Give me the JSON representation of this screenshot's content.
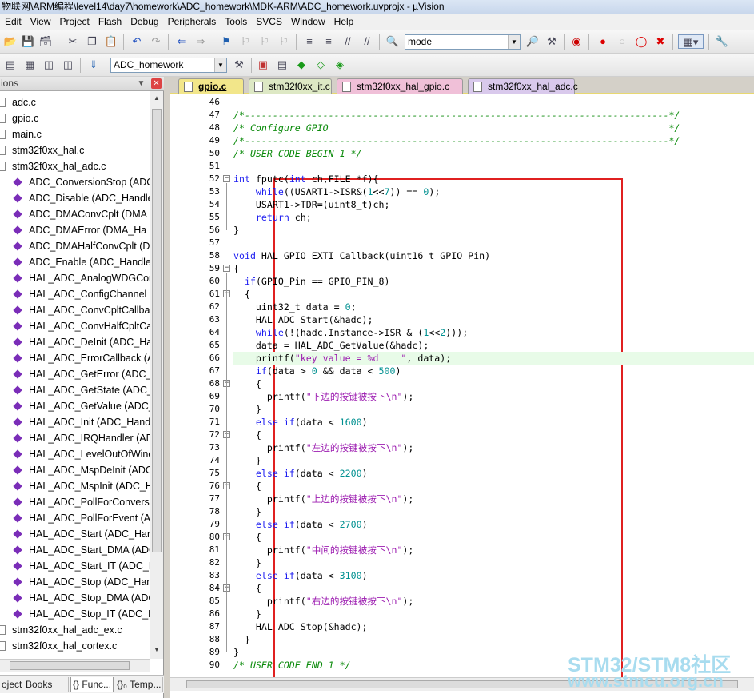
{
  "window": {
    "title": "物联网\\ARM编程\\level14\\day7\\homework\\ADC_homework\\MDK-ARM\\ADC_homework.uvprojx - µVision"
  },
  "menu": [
    "Edit",
    "View",
    "Project",
    "Flash",
    "Debug",
    "Peripherals",
    "Tools",
    "SVCS",
    "Window",
    "Help"
  ],
  "toolbar": {
    "find_value": "mode",
    "target_value": "ADC_homework"
  },
  "project_panel": {
    "title": "ions",
    "tree": [
      {
        "kind": "file",
        "label": "adc.c"
      },
      {
        "kind": "file",
        "label": "gpio.c"
      },
      {
        "kind": "file",
        "label": "main.c"
      },
      {
        "kind": "file",
        "label": "stm32f0xx_hal.c"
      },
      {
        "kind": "file",
        "label": "stm32f0xx_hal_adc.c"
      },
      {
        "kind": "func",
        "label": "ADC_ConversionStop (ADC"
      },
      {
        "kind": "func",
        "label": "ADC_Disable (ADC_Handle"
      },
      {
        "kind": "func",
        "label": "ADC_DMAConvCplt (DMA"
      },
      {
        "kind": "func",
        "label": "ADC_DMAError (DMA_Ha"
      },
      {
        "kind": "func",
        "label": "ADC_DMAHalfConvCplt (D"
      },
      {
        "kind": "func",
        "label": "ADC_Enable (ADC_Handle"
      },
      {
        "kind": "func",
        "label": "HAL_ADC_AnalogWDGCon"
      },
      {
        "kind": "func",
        "label": "HAL_ADC_ConfigChannel ("
      },
      {
        "kind": "func",
        "label": "HAL_ADC_ConvCpltCallba"
      },
      {
        "kind": "func",
        "label": "HAL_ADC_ConvHalfCpltCa"
      },
      {
        "kind": "func",
        "label": "HAL_ADC_DeInit (ADC_Ha"
      },
      {
        "kind": "func",
        "label": "HAL_ADC_ErrorCallback (A"
      },
      {
        "kind": "func",
        "label": "HAL_ADC_GetError (ADC_"
      },
      {
        "kind": "func",
        "label": "HAL_ADC_GetState (ADC_I"
      },
      {
        "kind": "func",
        "label": "HAL_ADC_GetValue (ADC_"
      },
      {
        "kind": "func",
        "label": "HAL_ADC_Init (ADC_Handl"
      },
      {
        "kind": "func",
        "label": "HAL_ADC_IRQHandler (AD"
      },
      {
        "kind": "func",
        "label": "HAL_ADC_LevelOutOfWinc"
      },
      {
        "kind": "func",
        "label": "HAL_ADC_MspDeInit (ADC"
      },
      {
        "kind": "func",
        "label": "HAL_ADC_MspInit (ADC_H"
      },
      {
        "kind": "func",
        "label": "HAL_ADC_PollForConversi"
      },
      {
        "kind": "func",
        "label": "HAL_ADC_PollForEvent (AI"
      },
      {
        "kind": "func",
        "label": "HAL_ADC_Start (ADC_Hanc"
      },
      {
        "kind": "func",
        "label": "HAL_ADC_Start_DMA (ADC"
      },
      {
        "kind": "func",
        "label": "HAL_ADC_Start_IT (ADC_H"
      },
      {
        "kind": "func",
        "label": "HAL_ADC_Stop (ADC_Hanc"
      },
      {
        "kind": "func",
        "label": "HAL_ADC_Stop_DMA (ADC"
      },
      {
        "kind": "func",
        "label": "HAL_ADC_Stop_IT (ADC_H"
      },
      {
        "kind": "file",
        "label": "stm32f0xx_hal_adc_ex.c"
      },
      {
        "kind": "file",
        "label": "stm32f0xx_hal_cortex.c"
      }
    ],
    "bottom_tabs": [
      "oject",
      "Books",
      "{} Func...",
      "{}₀ Temp..."
    ]
  },
  "editor": {
    "tabs": [
      {
        "label": "gpio.c",
        "active": true,
        "color": "#f2e68a"
      },
      {
        "label": "stm32f0xx_it.c",
        "active": false,
        "color": "#dde8c4"
      },
      {
        "label": "stm32f0xx_hal_gpio.c",
        "active": false,
        "color": "#f0c0d8"
      },
      {
        "label": "stm32f0xx_hal_adc.c",
        "active": false,
        "color": "#d9c9ec"
      }
    ],
    "lines": [
      {
        "n": "46",
        "text": ""
      },
      {
        "n": "47",
        "text": "/*----------------------------------------------------------------------------*/"
      },
      {
        "n": "48",
        "text": "/* Configure GPIO                                                             */"
      },
      {
        "n": "49",
        "text": "/*----------------------------------------------------------------------------*/"
      },
      {
        "n": "50",
        "text": "/* USER CODE BEGIN 1 */"
      },
      {
        "n": "51",
        "text": ""
      },
      {
        "n": "52",
        "text": "int fputc(int ch,FILE *f){"
      },
      {
        "n": "53",
        "text": "    while((USART1->ISR&(1<<7)) == 0);"
      },
      {
        "n": "54",
        "text": "    USART1->TDR=(uint8_t)ch;"
      },
      {
        "n": "55",
        "text": "    return ch;"
      },
      {
        "n": "56",
        "text": "}"
      },
      {
        "n": "57",
        "text": ""
      },
      {
        "n": "58",
        "text": "void HAL_GPIO_EXTI_Callback(uint16_t GPIO_Pin)"
      },
      {
        "n": "59",
        "text": "{"
      },
      {
        "n": "60",
        "text": "  if(GPIO_Pin == GPIO_PIN_8)"
      },
      {
        "n": "61",
        "text": "  {"
      },
      {
        "n": "62",
        "text": "    uint32_t data = 0;"
      },
      {
        "n": "63",
        "text": "    HAL_ADC_Start(&hadc);"
      },
      {
        "n": "64",
        "text": "    while(!(hadc.Instance->ISR & (1<<2)));"
      },
      {
        "n": "65",
        "text": "    data = HAL_ADC_GetValue(&hadc);"
      },
      {
        "n": "66",
        "text": "    printf(\"key value = %d    \", data);"
      },
      {
        "n": "67",
        "text": "    if(data > 0 && data < 500)"
      },
      {
        "n": "68",
        "text": "    {"
      },
      {
        "n": "69",
        "text": "      printf(\"下边的按键被按下\\n\");"
      },
      {
        "n": "70",
        "text": "    }"
      },
      {
        "n": "71",
        "text": "    else if(data < 1600)"
      },
      {
        "n": "72",
        "text": "    {"
      },
      {
        "n": "73",
        "text": "      printf(\"左边的按键被按下\\n\");"
      },
      {
        "n": "74",
        "text": "    }"
      },
      {
        "n": "75",
        "text": "    else if(data < 2200)"
      },
      {
        "n": "76",
        "text": "    {"
      },
      {
        "n": "77",
        "text": "      printf(\"上边的按键被按下\\n\");"
      },
      {
        "n": "78",
        "text": "    }"
      },
      {
        "n": "79",
        "text": "    else if(data < 2700)"
      },
      {
        "n": "80",
        "text": "    {"
      },
      {
        "n": "81",
        "text": "      printf(\"中间的按键被按下\\n\");"
      },
      {
        "n": "82",
        "text": "    }"
      },
      {
        "n": "83",
        "text": "    else if(data < 3100)"
      },
      {
        "n": "84",
        "text": "    {"
      },
      {
        "n": "85",
        "text": "      printf(\"右边的按键被按下\\n\");"
      },
      {
        "n": "86",
        "text": "    }"
      },
      {
        "n": "87",
        "text": "    HAL_ADC_Stop(&hadc);"
      },
      {
        "n": "88",
        "text": "  }"
      },
      {
        "n": "89",
        "text": "}"
      },
      {
        "n": "90",
        "text": "/* USER CODE END 1 */"
      }
    ],
    "highlight_color": "#e8fbe8",
    "annotation_color": "#e02020"
  },
  "watermark": {
    "line1": "STM32/STM8社区",
    "line2": "www.stmcu.org.cn"
  }
}
